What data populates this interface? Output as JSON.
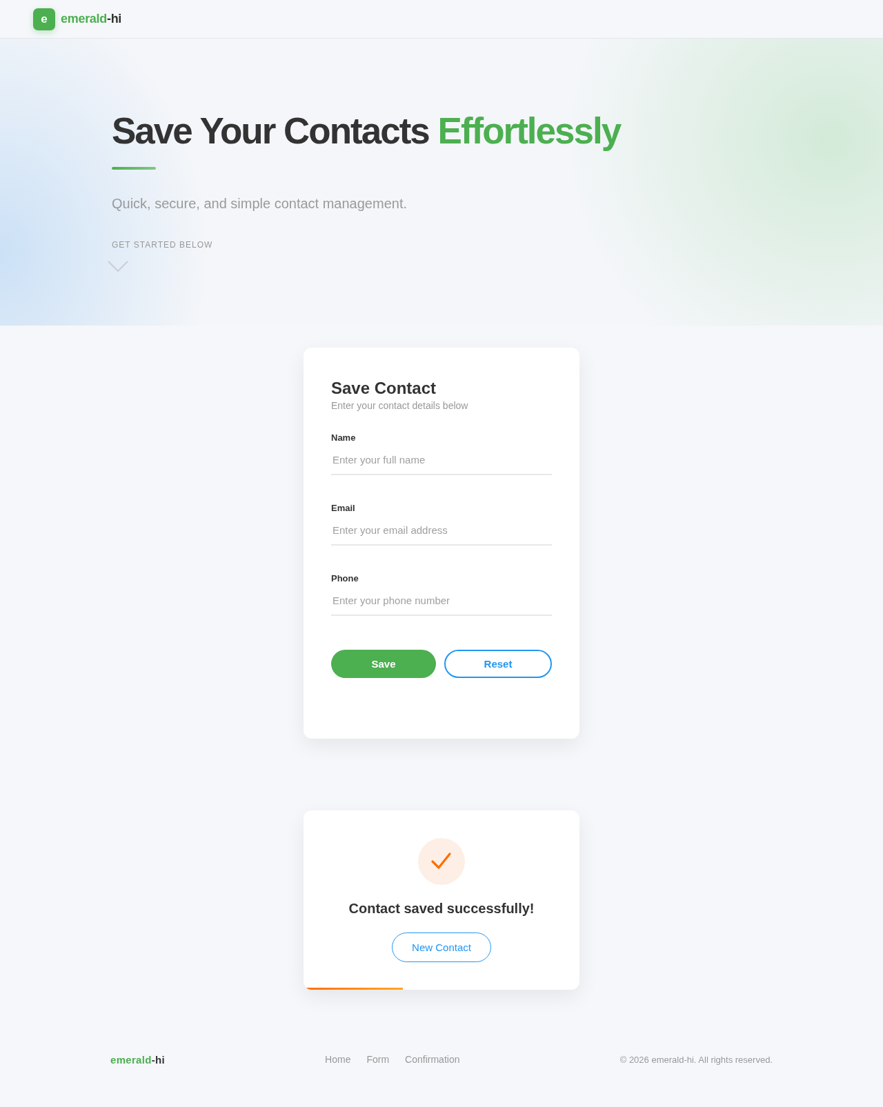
{
  "header": {
    "logo_letter": "e",
    "brand": {
      "primary": "emerald",
      "suffix": "-hi"
    }
  },
  "hero": {
    "title": "Save Your Contacts",
    "title_highlight": "Effortlessly",
    "subtitle": "Quick, secure, and simple contact management.",
    "cta": "GET STARTED BELOW"
  },
  "form_card": {
    "title": "Save Contact",
    "subtitle": "Enter your contact details below",
    "fields": [
      {
        "label": "Name",
        "placeholder": "Enter your full name"
      },
      {
        "label": "Email",
        "placeholder": "Enter your email address"
      },
      {
        "label": "Phone",
        "placeholder": "Enter your phone number"
      }
    ],
    "buttons": [
      {
        "label": "Save",
        "kind": "save"
      },
      {
        "label": "Reset",
        "kind": "reset"
      }
    ]
  },
  "confirmation": {
    "message": "Contact saved successfully!",
    "button": "New Contact",
    "progress": {
      "level": 0.36
    }
  },
  "footer": {
    "brand": {
      "primary": "emerald",
      "suffix": "-hi"
    },
    "links": [
      "Home",
      "Form",
      "Confirmation"
    ],
    "copyright": "© 2026 emerald-hi. All rights reserved."
  }
}
